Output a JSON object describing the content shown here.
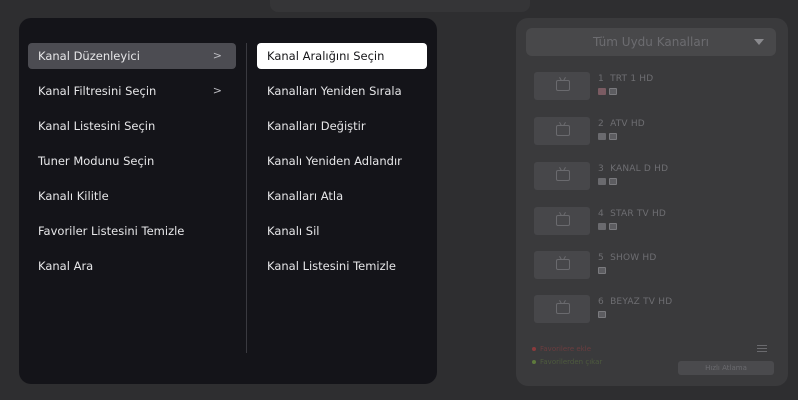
{
  "channel_panel": {
    "category": "Tüm Uydu Kanalları",
    "channels": [
      {
        "number": "1",
        "name": "TRT 1 HD",
        "badges": [
          "flag",
          "hd"
        ]
      },
      {
        "number": "2",
        "name": "ATV HD",
        "badges": [
          "plain",
          "hd"
        ]
      },
      {
        "number": "3",
        "name": "KANAL D HD",
        "badges": [
          "plain",
          "hd"
        ]
      },
      {
        "number": "4",
        "name": "STAR TV HD",
        "badges": [
          "plain",
          "hd"
        ]
      },
      {
        "number": "5",
        "name": "SHOW HD",
        "badges": [
          "hd"
        ]
      },
      {
        "number": "6",
        "name": "BEYAZ TV HD",
        "badges": [
          "hd"
        ]
      }
    ],
    "legend": {
      "add_favorites": "Favorilere ekle",
      "remove_favorites": "Favorilerden çıkar"
    },
    "quick_jump": "Hızlı Atlama"
  },
  "menu": {
    "left_items": [
      {
        "label": "Kanal Düzenleyici",
        "has_submenu": true
      },
      {
        "label": "Kanal Filtresini Seçin",
        "has_submenu": true
      },
      {
        "label": "Kanal Listesini Seçin"
      },
      {
        "label": "Tuner Modunu Seçin"
      },
      {
        "label": "Kanalı Kilitle"
      },
      {
        "label": "Favoriler Listesini Temizle"
      },
      {
        "label": "Kanal Ara"
      }
    ],
    "right_items": [
      {
        "label": "Kanal Aralığını Seçin"
      },
      {
        "label": "Kanalları Yeniden Sırala"
      },
      {
        "label": "Kanalları Değiştir"
      },
      {
        "label": "Kanalı Yeniden Adlandır"
      },
      {
        "label": "Kanalları Atla"
      },
      {
        "label": "Kanalı Sil"
      },
      {
        "label": "Kanal Listesini Temizle"
      }
    ],
    "chevron": ">"
  },
  "colors": {
    "panel_bg": "#141419",
    "highlight_active": "#4c4c52",
    "highlight_selected": "#ffffff"
  }
}
